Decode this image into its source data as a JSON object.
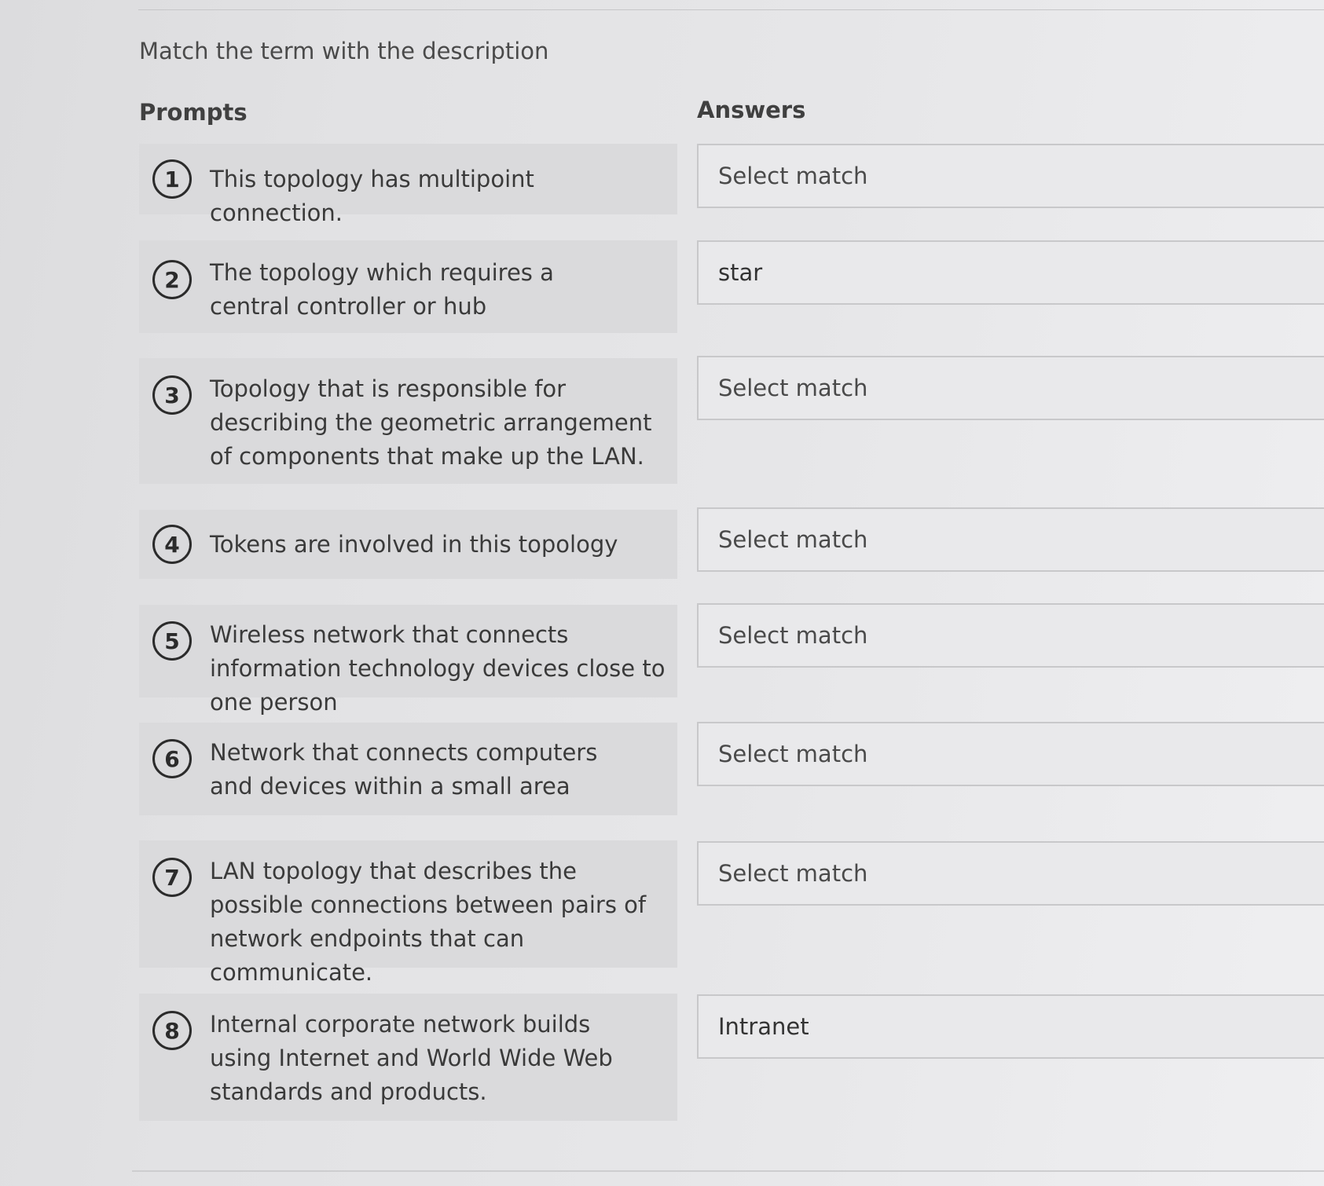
{
  "instruction": "Match the term with the description",
  "headings": {
    "prompts": "Prompts",
    "answers": "Answers"
  },
  "prompts": [
    {
      "number": "1",
      "text": "This topology has multipoint connection."
    },
    {
      "number": "2",
      "text": "The topology which requires a central controller or hub"
    },
    {
      "number": "3",
      "text": "Topology that is responsible for describing the geometric arrangement of components that make up the LAN."
    },
    {
      "number": "4",
      "text": "Tokens are involved in this topology"
    },
    {
      "number": "5",
      "text": "Wireless network that connects information technology devices close to one person"
    },
    {
      "number": "6",
      "text": "Network that connects computers and devices within a small area"
    },
    {
      "number": "7",
      "text": "LAN topology that describes the possible connections between pairs of network endpoints that can communicate."
    },
    {
      "number": "8",
      "text": "Internal corporate network builds using Internet and World Wide Web standards and products."
    }
  ],
  "answers": [
    {
      "value": "Select match"
    },
    {
      "value": "star"
    },
    {
      "value": "Select match"
    },
    {
      "value": "Select match"
    },
    {
      "value": "Select match"
    },
    {
      "value": "Select match"
    },
    {
      "value": "Select match"
    },
    {
      "value": "Intranet"
    }
  ]
}
